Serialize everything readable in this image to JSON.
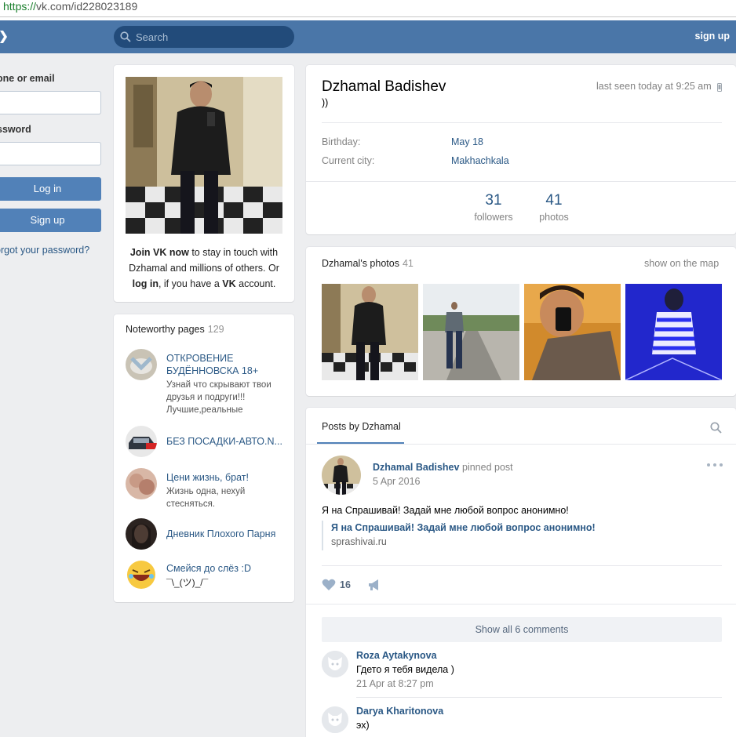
{
  "browser": {
    "url_scheme": "https://",
    "url_rest": "vk.com/id228023189"
  },
  "header": {
    "search_placeholder": "Search",
    "signup_label": "sign up"
  },
  "login": {
    "email_label": "one or email",
    "password_label": "ssword",
    "login_button": "Log in",
    "signup_button": "Sign up",
    "forgot_link": "orgot your password?"
  },
  "join": {
    "bold1": "Join VK now",
    "text1": " to stay in touch with Dzhamal and millions of others. Or ",
    "bold2": "log in",
    "text2": ", if you have a ",
    "bold3": "VK",
    "text3": " account."
  },
  "noteworthy": {
    "title": "Noteworthy pages",
    "count": "129",
    "items": [
      {
        "name": "ОТКРОВЕНИЕ БУДЁННОВСКА 18+",
        "desc": "Узнай что скрывают твои друзья и подруги!!! Лучшие,реальные"
      },
      {
        "name": "БЕЗ ПОСАДКИ-АВТО.N...",
        "desc": ""
      },
      {
        "name": "Цени жизнь, брат!",
        "desc": "Жизнь одна, нехуй стесняться."
      },
      {
        "name": "Дневник Плохого Парня",
        "desc": ""
      },
      {
        "name": "Смейся до слёз :D",
        "desc": "¯\\_(ツ)_/¯"
      }
    ]
  },
  "profile": {
    "name": "Dzhamal Badishev",
    "status": "))",
    "last_seen": "last seen today at 9:25 am",
    "birthday_label": "Birthday:",
    "birthday_value": "May 18",
    "city_label": "Current city:",
    "city_value": "Makhachkala",
    "followers_count": "31",
    "followers_label": "followers",
    "photos_count": "41",
    "photos_label": "photos"
  },
  "photos": {
    "title": "Dzhamal's photos",
    "count": "41",
    "map_link": "show on the map"
  },
  "posts": {
    "tab": "Posts by Dzhamal",
    "author": "Dzhamal Badishev",
    "pinned": "pinned post",
    "date": "5 Apr 2016",
    "text": "Я на Спрашивай! Задай мне любой вопрос анонимно!",
    "link_title": "Я на Спрашивай! Задай мне любой вопрос анонимно!",
    "link_domain": "sprashivai.ru",
    "likes": "16",
    "show_comments": "Show all 6 comments",
    "comments": [
      {
        "name": "Roza Aytakynova",
        "text": "Гдето я тебя видела )",
        "date": "21 Apr at 8:27 pm"
      },
      {
        "name": "Darya Kharitonova",
        "text": "эх)",
        "date": ""
      }
    ]
  },
  "colors": {
    "header": "#4a76a8",
    "accent": "#5181b8",
    "link": "#2a5885",
    "background": "#edeef0"
  }
}
